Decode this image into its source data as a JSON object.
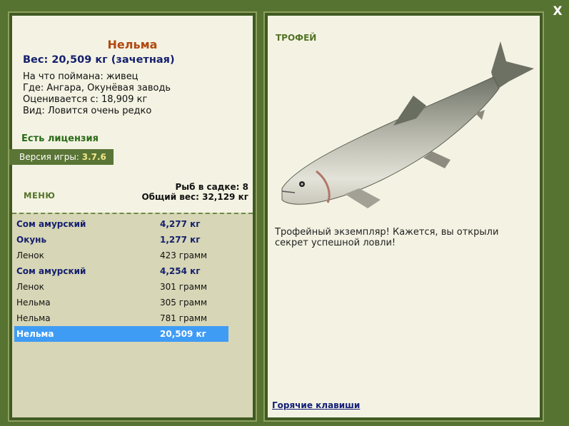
{
  "window": {
    "close_label": "X"
  },
  "fish_info": {
    "name": "Нельма",
    "weight_line": "Вес: 20,509 кг (зачетная)",
    "caught_with": "На что поймана: живец",
    "location": "Где: Ангара, Окунёвая заводь",
    "valued_at": "Оценивается с: 18,909 кг",
    "species_note": "Вид: Ловится очень редко"
  },
  "license": {
    "text": "Есть лицензия"
  },
  "version": {
    "label": "Версия игры:",
    "value": "3.7.6"
  },
  "menu": {
    "label": "МЕНЮ"
  },
  "keepnet": {
    "count_text": "Рыб в садке: 8",
    "total_weight_text": "Общий вес: 32,129 кг"
  },
  "catch_list": [
    {
      "name": "Сом амурский",
      "weight": "4,277 кг",
      "trophy": true,
      "selected": false
    },
    {
      "name": "Окунь",
      "weight": "1,277 кг",
      "trophy": true,
      "selected": false
    },
    {
      "name": "Ленок",
      "weight": "423 грамм",
      "trophy": false,
      "selected": false
    },
    {
      "name": "Сом амурский",
      "weight": "4,254 кг",
      "trophy": true,
      "selected": false
    },
    {
      "name": "Ленок",
      "weight": "301 грамм",
      "trophy": false,
      "selected": false
    },
    {
      "name": "Нельма",
      "weight": "305 грамм",
      "trophy": false,
      "selected": false
    },
    {
      "name": "Нельма",
      "weight": "781 грамм",
      "trophy": false,
      "selected": false
    },
    {
      "name": "Нельма",
      "weight": "20,509 кг",
      "trophy": true,
      "selected": true
    }
  ],
  "trophy": {
    "title": "ТРОФЕЙ",
    "text": "Трофейный экземпляр! Кажется, вы открыли секрет успешной ловли!",
    "image_icon": "fish-image"
  },
  "hotkeys": {
    "label": "Горячие клавиши"
  },
  "colors": {
    "background": "#577331",
    "panel": "#f4f3e3",
    "list_bg": "#d7d6b6",
    "fish_name": "#b24811",
    "trophy_text": "#15206e",
    "selected_row": "#3f9cf5"
  }
}
